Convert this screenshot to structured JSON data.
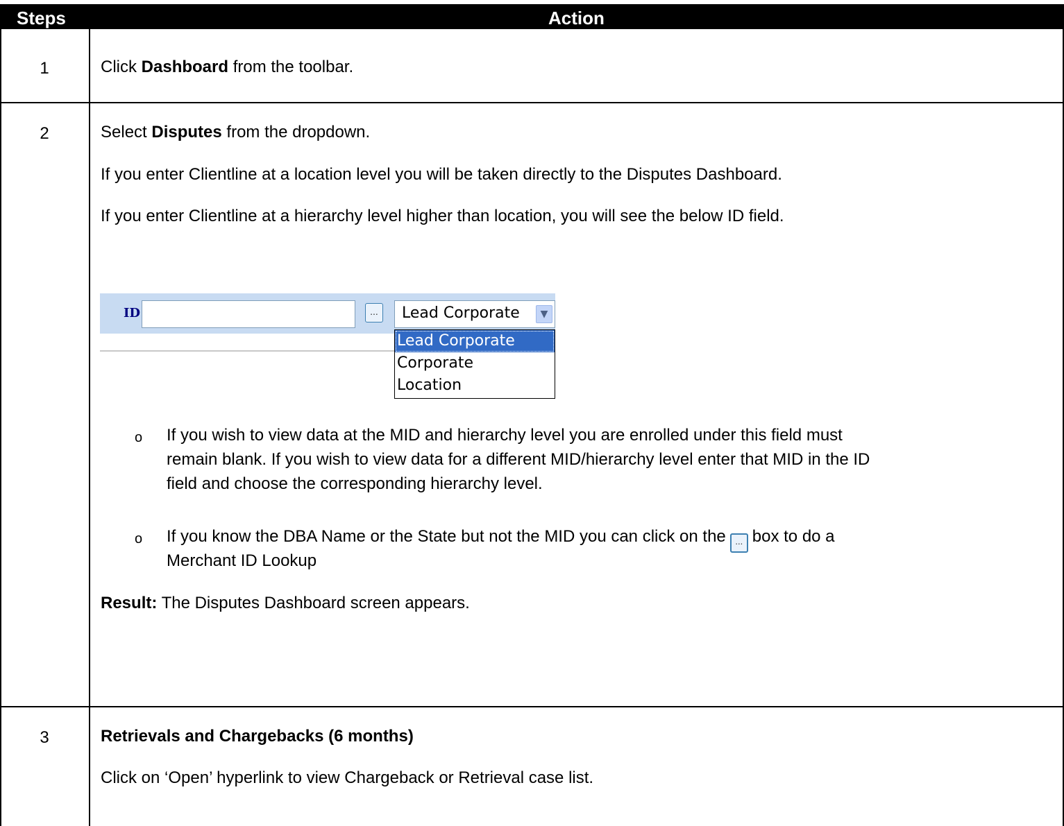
{
  "table": {
    "header": {
      "steps": "Steps",
      "action": "Action"
    },
    "rows": [
      {
        "num": "1",
        "line1_prefix": "Click ",
        "line1_bold": "Dashboard",
        "line1_suffix": " from the toolbar."
      },
      {
        "num": "2",
        "line1_prefix": "Select ",
        "line1_bold": "Disputes",
        "line1_suffix": " from the dropdown.",
        "para1": "If you enter Clientline at a location level you will be taken directly to the Disputes Dashboard.",
        "para2": "If you enter Clientline at a hierarchy level higher than location, you will see the below ID field.",
        "bullet1_line1": "If you wish to view data at the MID and hierarchy level you are enrolled under this field must",
        "bullet1_line2": "remain blank.  If you wish to view data for a different MID/hierarchy level enter that MID in the ID",
        "bullet1_line3": "field and choose the corresponding hierarchy level.",
        "bullet2_line1_prefix": "If you know the DBA Name or the State but not the MID you can click on the",
        "bullet2_line1_suffix": "box to do a",
        "bullet2_line2": "Merchant ID Lookup",
        "result_label": "Result:",
        "result_text": " The Disputes Dashboard screen appears."
      },
      {
        "num": "3",
        "title": "Retrievals and Chargebacks (6 months)",
        "para1": "Click on ‘Open’ hyperlink to view Chargeback or Retrieval case list."
      }
    ]
  },
  "id_widget": {
    "label": "ID",
    "input_value": "",
    "lookup_button": "...",
    "select_value": "Lead Corporate",
    "options": [
      "Lead Corporate",
      "Corporate",
      "Location"
    ],
    "bullet_glyph": "o"
  }
}
